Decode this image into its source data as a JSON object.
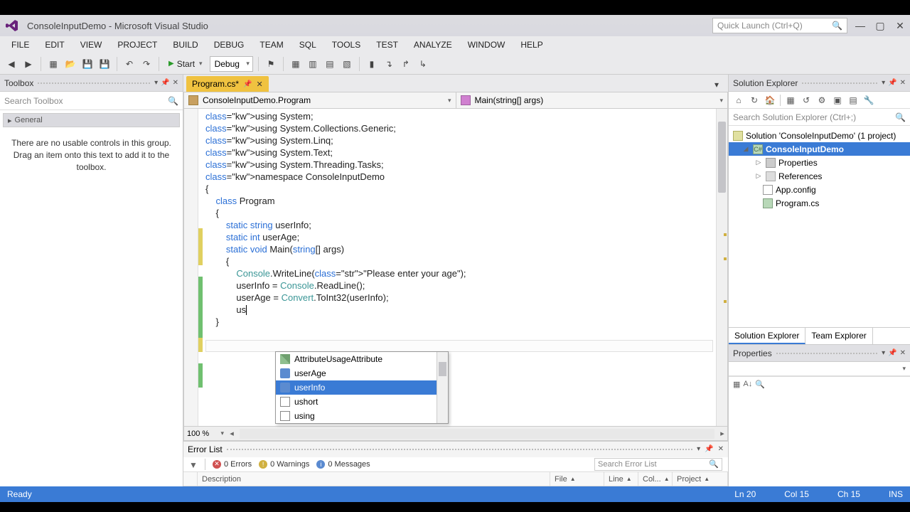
{
  "title": "ConsoleInputDemo - Microsoft Visual Studio",
  "quick_launch": {
    "placeholder": "Quick Launch (Ctrl+Q)"
  },
  "menu": [
    "FILE",
    "EDIT",
    "VIEW",
    "PROJECT",
    "BUILD",
    "DEBUG",
    "TEAM",
    "SQL",
    "TOOLS",
    "TEST",
    "ANALYZE",
    "WINDOW",
    "HELP"
  ],
  "toolbar": {
    "start": "Start",
    "config": "Debug"
  },
  "toolbox": {
    "title": "Toolbox",
    "search_placeholder": "Search Toolbox",
    "category": "General",
    "empty_msg": "There are no usable controls in this group. Drag an item onto this text to add it to the toolbox."
  },
  "document": {
    "tab": "Program.cs*",
    "nav_left": "ConsoleInputDemo.Program",
    "nav_right": "Main(string[] args)",
    "zoom": "100 %",
    "typed": "us",
    "code_lines": [
      {
        "t": "using System;",
        "i": 0
      },
      {
        "t": "using System.Collections.Generic;",
        "i": 0
      },
      {
        "t": "using System.Linq;",
        "i": 0
      },
      {
        "t": "using System.Text;",
        "i": 0
      },
      {
        "t": "using System.Threading.Tasks;",
        "i": 0
      },
      {
        "t": "",
        "i": 0
      },
      {
        "t": "namespace ConsoleInputDemo",
        "i": 0
      },
      {
        "t": "{",
        "i": 0
      },
      {
        "t": "class Program",
        "i": 1
      },
      {
        "t": "{",
        "i": 1
      },
      {
        "t": "static string userInfo;",
        "i": 2
      },
      {
        "t": "static int userAge;",
        "i": 2
      },
      {
        "t": "",
        "i": 0
      },
      {
        "t": "static void Main(string[] args)",
        "i": 2
      },
      {
        "t": "{",
        "i": 2
      },
      {
        "t": "Console.WriteLine(\"Please enter your age\");",
        "i": 3
      },
      {
        "t": "userInfo = Console.ReadLine();",
        "i": 3
      },
      {
        "t": "userAge = Convert.ToInt32(userInfo);",
        "i": 3
      },
      {
        "t": "",
        "i": 0
      },
      {
        "t": "us",
        "i": 3,
        "caret": true
      },
      {
        "t": "",
        "i": 0
      },
      {
        "t": "",
        "i": 0
      },
      {
        "t": "}",
        "i": 1
      }
    ]
  },
  "intellisense": {
    "items": [
      {
        "label": "AttributeUsageAttribute",
        "icon": "attr"
      },
      {
        "label": "userAge",
        "icon": "field"
      },
      {
        "label": "userInfo",
        "icon": "field",
        "selected": true
      },
      {
        "label": "ushort",
        "icon": "struct"
      },
      {
        "label": "using",
        "icon": "struct"
      }
    ]
  },
  "error_list": {
    "title": "Error List",
    "errors": "0 Errors",
    "warnings": "0 Warnings",
    "messages": "0 Messages",
    "search_placeholder": "Search Error List",
    "cols": [
      "Description",
      "File",
      "Line",
      "Col...",
      "Project"
    ]
  },
  "solution_explorer": {
    "title": "Solution Explorer",
    "search_placeholder": "Search Solution Explorer (Ctrl+;)",
    "root": "Solution 'ConsoleInputDemo' (1 project)",
    "project": "ConsoleInputDemo",
    "nodes": [
      "Properties",
      "References",
      "App.config",
      "Program.cs"
    ],
    "tabs": [
      "Solution Explorer",
      "Team Explorer"
    ]
  },
  "properties": {
    "title": "Properties"
  },
  "status": {
    "ready": "Ready",
    "ln": "Ln 20",
    "col": "Col 15",
    "ch": "Ch 15",
    "ins": "INS"
  }
}
